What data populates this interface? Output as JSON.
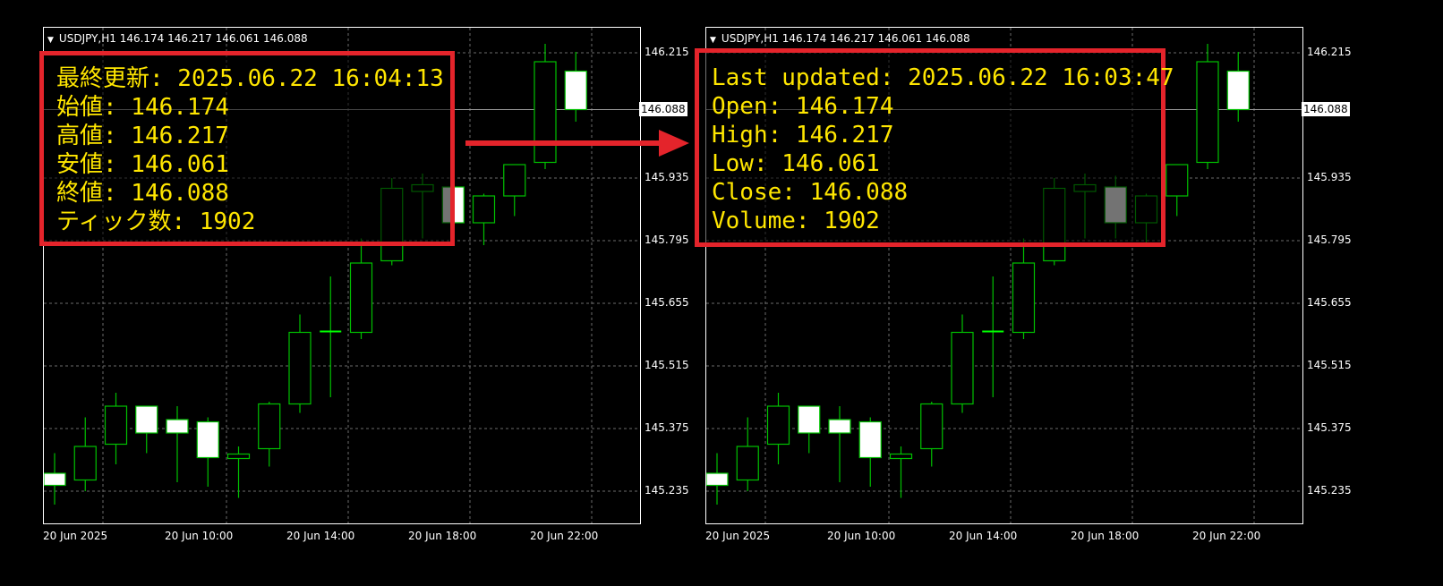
{
  "colors": {
    "background": "#000000",
    "grid": "#6b6b6b",
    "bull_candle": "#00c000",
    "bear_candle_fill": "#ffffff",
    "doji": "#00ff00",
    "highlight_border": "#e4242b",
    "info_text": "#ffe600"
  },
  "left_chart": {
    "header": "USDJPY,H1  146.174 146.217 146.061 146.088",
    "price_labels": [
      "146.215",
      "145.935",
      "145.795",
      "145.655",
      "145.515",
      "145.375",
      "145.235"
    ],
    "current_price": "146.088",
    "time_labels": [
      "20 Jun 2025",
      "20 Jun 10:00",
      "20 Jun 14:00",
      "20 Jun 18:00",
      "20 Jun 22:00"
    ],
    "info_lines": [
      "最終更新: 2025.06.22 16:04:13",
      "始値: 146.174",
      "高値: 146.217",
      "安値: 146.061",
      "終値: 146.088",
      "ティック数: 1902"
    ]
  },
  "right_chart": {
    "header": "USDJPY,H1  146.174 146.217 146.061 146.088",
    "price_labels": [
      "146.215",
      "145.935",
      "145.795",
      "145.655",
      "145.515",
      "145.375",
      "145.235"
    ],
    "current_price": "146.088",
    "time_labels": [
      "20 Jun 2025",
      "20 Jun 10:00",
      "20 Jun 14:00",
      "20 Jun 18:00",
      "20 Jun 22:00"
    ],
    "info_lines": [
      "Last updated: 2025.06.22 16:03:47",
      "Open: 146.174",
      "High: 146.217",
      "Low: 146.061",
      "Close: 146.088",
      "Volume: 1902"
    ]
  },
  "candles": [
    {
      "o": 145.275,
      "h": 145.32,
      "l": 145.205,
      "c": 145.248
    },
    {
      "o": 145.26,
      "h": 145.4,
      "l": 145.235,
      "c": 145.335
    },
    {
      "o": 145.34,
      "h": 145.455,
      "l": 145.295,
      "c": 145.425
    },
    {
      "o": 145.425,
      "h": 145.425,
      "l": 145.32,
      "c": 145.365
    },
    {
      "o": 145.395,
      "h": 145.425,
      "l": 145.255,
      "c": 145.365
    },
    {
      "o": 145.39,
      "h": 145.4,
      "l": 145.245,
      "c": 145.31
    },
    {
      "o": 145.308,
      "h": 145.335,
      "l": 145.22,
      "c": 145.318
    },
    {
      "o": 145.33,
      "h": 145.435,
      "l": 145.29,
      "c": 145.43
    },
    {
      "o": 145.43,
      "h": 145.63,
      "l": 145.41,
      "c": 145.59
    },
    {
      "o": 145.588,
      "h": 145.715,
      "l": 145.445,
      "c": 145.592
    },
    {
      "o": 145.59,
      "h": 145.8,
      "l": 145.575,
      "c": 145.745
    },
    {
      "o": 145.75,
      "h": 145.935,
      "l": 145.74,
      "c": 145.912
    },
    {
      "o": 145.905,
      "h": 145.945,
      "l": 145.8,
      "c": 145.92
    },
    {
      "o": 145.915,
      "h": 145.94,
      "l": 145.8,
      "c": 145.835
    },
    {
      "o": 145.835,
      "h": 145.9,
      "l": 145.785,
      "c": 145.895
    },
    {
      "o": 145.895,
      "h": 145.965,
      "l": 145.85,
      "c": 145.965
    },
    {
      "o": 145.97,
      "h": 146.235,
      "l": 145.955,
      "c": 146.195
    },
    {
      "o": 146.174,
      "h": 146.217,
      "l": 146.061,
      "c": 146.088
    }
  ]
}
